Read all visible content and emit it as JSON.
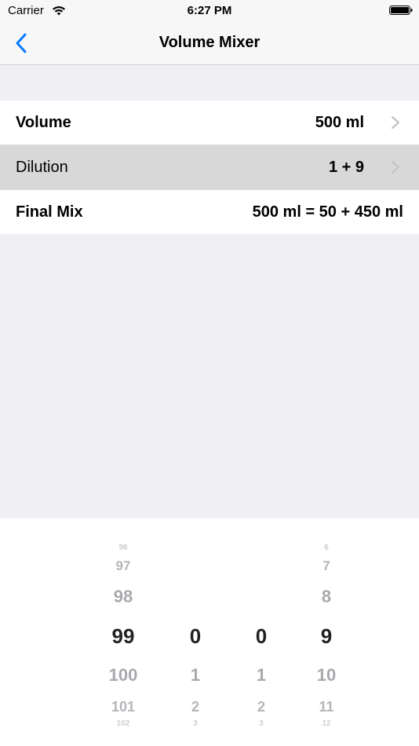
{
  "status_bar": {
    "carrier": "Carrier",
    "time": "6:27 PM"
  },
  "nav": {
    "title": "Volume Mixer"
  },
  "rows": [
    {
      "label": "Volume",
      "value": "500 ml"
    },
    {
      "label": "Dilution",
      "value": "1 + 9"
    },
    {
      "label": "Final Mix",
      "value": "500 ml = 50 + 450 ml"
    }
  ],
  "picker": {
    "columns": [
      {
        "selected": "99",
        "above": [
          "96",
          "97",
          "98"
        ],
        "below": [
          "100",
          "101",
          "102"
        ]
      },
      {
        "selected": "0",
        "above": [],
        "below": [
          "1",
          "2",
          "3"
        ]
      },
      {
        "selected": "0",
        "above": [],
        "below": [
          "1",
          "2",
          "3"
        ]
      },
      {
        "selected": "9",
        "above": [
          "6",
          "7",
          "8"
        ],
        "below": [
          "10",
          "11",
          "12"
        ]
      }
    ]
  },
  "colors": {
    "accent": "#0a7aff",
    "selected_row": "#d8d8d8"
  },
  "icons": {
    "back": "chevron-left-icon",
    "disclosure": "chevron-right-icon",
    "wifi": "wifi-icon",
    "battery": "battery-icon"
  }
}
